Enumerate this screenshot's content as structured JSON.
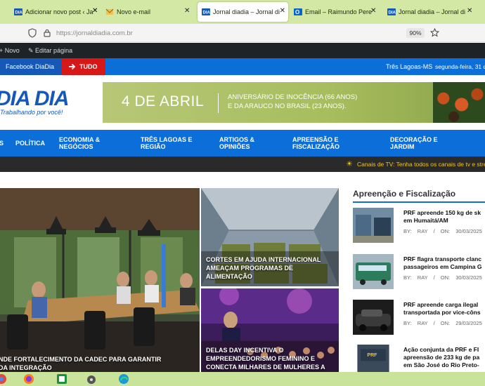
{
  "browser": {
    "tabs": [
      {
        "label": "Adicionar novo post ‹ Ja"
      },
      {
        "label": "Novo e-mail"
      },
      {
        "label": "Jornal diadia – Jornal di"
      },
      {
        "label": "Email – Raimundo Pere"
      },
      {
        "label": "Jornal diadia – Jornal di"
      }
    ],
    "url": "https://jornaldiadia.com.br",
    "zoom": "90%",
    "close_glyph": "✕"
  },
  "admin_bar": {
    "new_label": "Novo",
    "edit_label": "Editar página"
  },
  "top_strip": {
    "facebook_label": "Facebook DiaDia",
    "tudo_label": "TUDO",
    "location": "Três Lagoas-MS",
    "date": "segunda-feira, 31 de"
  },
  "header": {
    "logo_text": "DIA DIA",
    "tagline": "Trabalhando por você!",
    "banner_big": "4 DE ABRIL",
    "banner_line1": "ANIVERSÁRIO DE INOCÊNCIA (66 ANOS)",
    "banner_line2": "E DA ARAUCO NO BRASIL (23 ANOS)."
  },
  "main_nav": {
    "items": [
      {
        "label": "S"
      },
      {
        "label": "POLÍTICA"
      },
      {
        "label": "ECONOMIA &\nNEGÓCIOS"
      },
      {
        "label": "TRÊS LAGOAS E\nREGIÃO"
      },
      {
        "label": "ARTIGOS &\nOPINIÕES"
      },
      {
        "label": "APREENSÃO E\nFISCALIZAÇÃO"
      },
      {
        "label": "DECORAÇÃO E\nJARDIM"
      }
    ]
  },
  "ticker": {
    "text": "Canais de TV: Tenha todos os canais de tv e stre"
  },
  "featured": [
    {
      "caption": "NDE FORTALECIMENTO DA CADEC PARA GARANTIR\nDA INTEGRAÇÃO"
    },
    {
      "caption": "CORTES EM AJUDA INTERNACIONAL\nAMEAÇAM PROGRAMAS DE\nALIMENTAÇÃO"
    },
    {
      "caption": "DELAS DAY INCENTIVA O\nEMPREENDEDORISMO FEMININO E\nCONECTA MILHARES DE MULHERES A"
    }
  ],
  "sidebar": {
    "title": "Apreenção e Fiscalização",
    "items": [
      {
        "title": "PRF apreende 150 kg de sk\nem Humaitá/AM",
        "by": "BY:",
        "author": "RAY",
        "on": "ON:",
        "date": "30/03/2025"
      },
      {
        "title": "PRF flagra transporte clanc\npassageiros em Campina G",
        "by": "BY:",
        "author": "RAY",
        "on": "ON:",
        "date": "30/03/2025"
      },
      {
        "title": "PRF apreende carga ilegal\ntransportada por vice-côns",
        "by": "BY:",
        "author": "RAY",
        "on": "ON:",
        "date": "29/03/2025"
      },
      {
        "title": "Ação conjunta da PRF e FI\napreensão de 233 kg de pa\nem São José do Rio Preto-",
        "by": "",
        "author": "",
        "on": "",
        "date": ""
      }
    ]
  },
  "colors": {
    "brand_blue": "#0c6fd9",
    "tudo_red": "#d71818",
    "tab_green": "#d3e8a5"
  }
}
